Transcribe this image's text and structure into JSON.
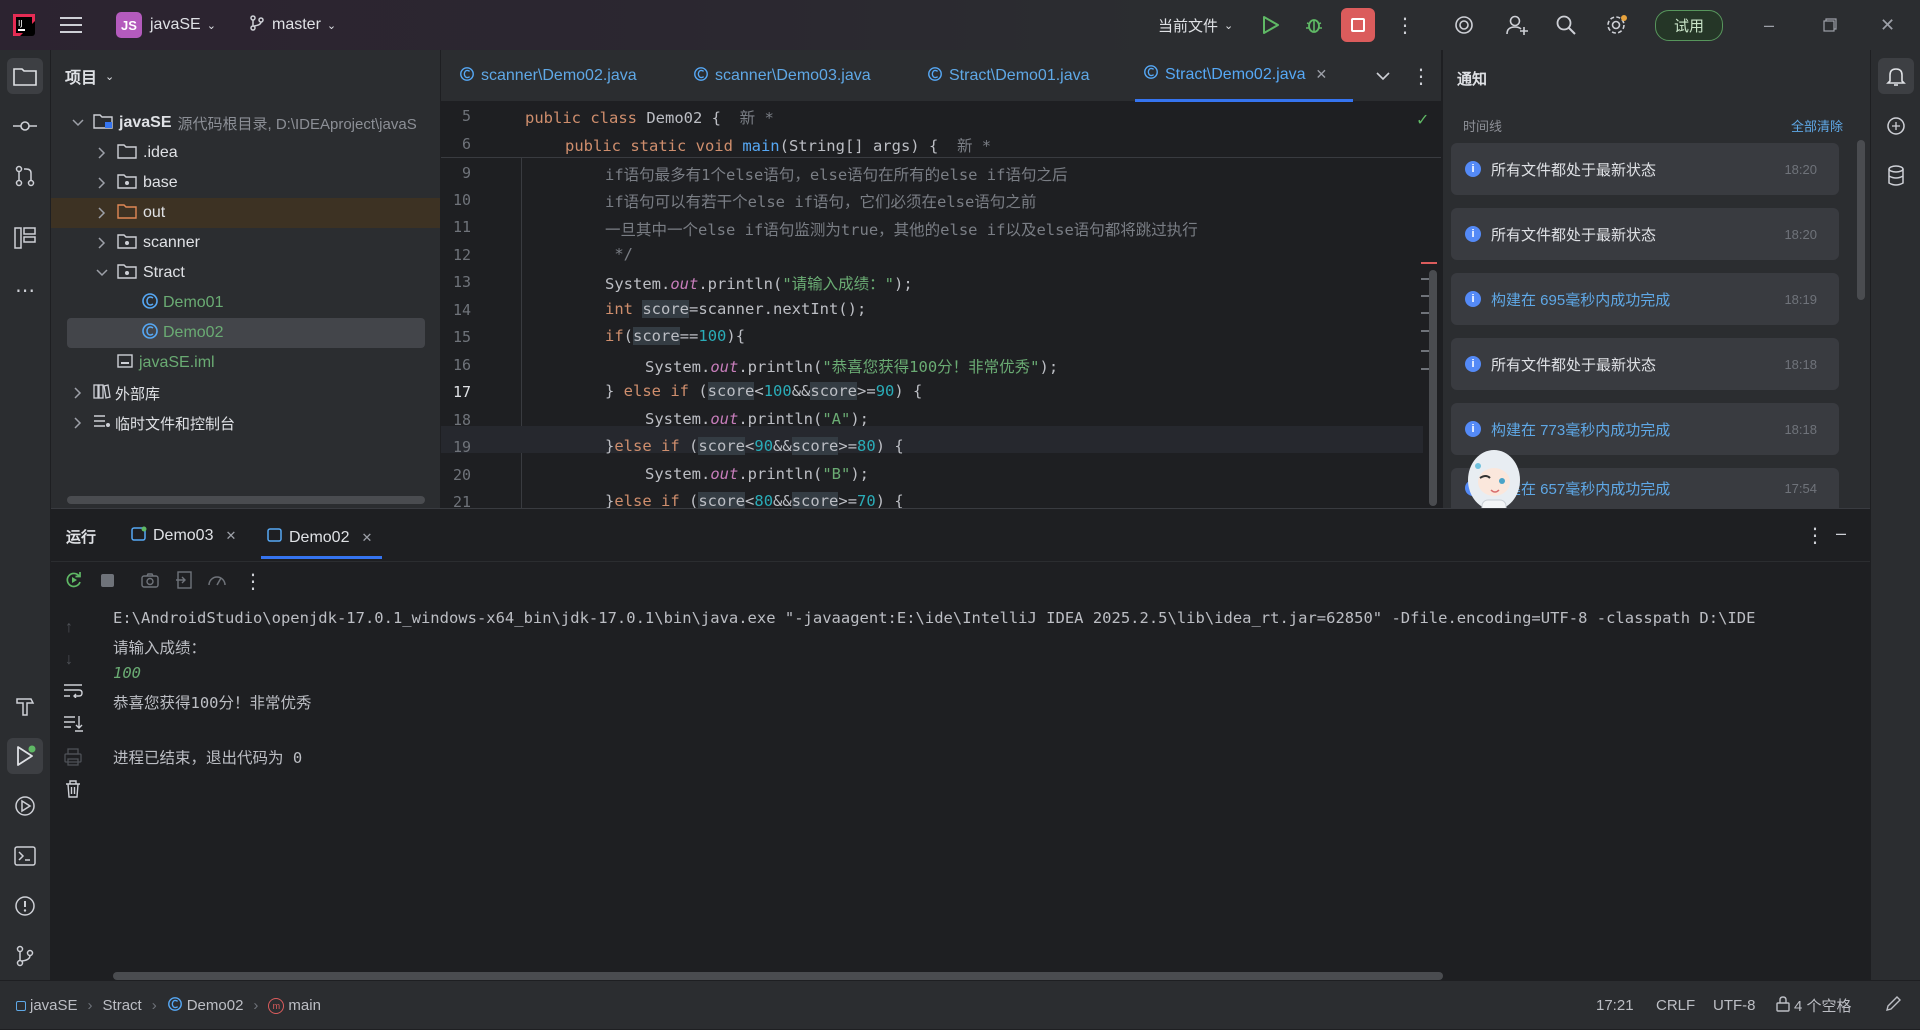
{
  "titlebar": {
    "logo": "intellij-logo",
    "project_badge": "JS",
    "project_name": "javaSE",
    "branch": "master",
    "run_config": "当前文件",
    "trial": "试用"
  },
  "project_panel": {
    "title": "项目",
    "root_name": "javaSE",
    "root_hint": "源代码根目录, D:\\IDEAproject\\javaSE",
    "items": [
      {
        "label": ".idea"
      },
      {
        "label": "base"
      },
      {
        "label": "out"
      },
      {
        "label": "scanner"
      },
      {
        "label": "Stract"
      },
      {
        "label": "Demo01"
      },
      {
        "label": "Demo02"
      },
      {
        "label": "javaSE.iml"
      },
      {
        "label": "外部库"
      },
      {
        "label": "临时文件和控制台"
      }
    ]
  },
  "editor": {
    "tabs": [
      {
        "label": "scanner\\Demo02.java"
      },
      {
        "label": "scanner\\Demo03.java"
      },
      {
        "label": "Stract\\Demo01.java"
      },
      {
        "label": "Stract\\Demo02.java"
      }
    ],
    "line_numbers": [
      "5",
      "6",
      "9",
      "10",
      "11",
      "12",
      "13",
      "14",
      "15",
      "16",
      "17",
      "18",
      "19",
      "20",
      "21"
    ],
    "sticky_hint": "新 *",
    "sticky_hint2": "新 *",
    "comment1": "if语句最多有1个else语句，else语句在所有的else if语句之后",
    "comment2": "if语句可以有若干个else if语句，它们必须在else语句之前",
    "comment3": "一旦其中一个else if语句监测为true，其他的else if以及else语句都将跳过执行",
    "comment4": " */",
    "str_prompt": "\"请输入成绩：\"",
    "str_congrats": "\"恭喜您获得100分！非常优秀\"",
    "str_a": "\"A\"",
    "str_b": "\"B\""
  },
  "notifications": {
    "title": "通知",
    "timeline": "时间线",
    "clear_all": "全部清除",
    "items": [
      {
        "text": "所有文件都处于最新状态",
        "time": "18:20",
        "link": false
      },
      {
        "text": "所有文件都处于最新状态",
        "time": "18:20",
        "link": false
      },
      {
        "text": "构建在 695毫秒内成功完成",
        "time": "18:19",
        "link": true
      },
      {
        "text": "所有文件都处于最新状态",
        "time": "18:18",
        "link": false
      },
      {
        "text": "构建在 773毫秒内成功完成",
        "time": "18:18",
        "link": true
      },
      {
        "text": "构建在 657毫秒内成功完成",
        "time": "17:54",
        "link": true
      }
    ]
  },
  "run_panel": {
    "title": "运行",
    "tabs": [
      {
        "label": "Demo03"
      },
      {
        "label": "Demo02"
      }
    ],
    "console": {
      "command": "E:\\AndroidStudio\\openjdk-17.0.1_windows-x64_bin\\jdk-17.0.1\\bin\\java.exe \"-javaagent:E:\\ide\\IntelliJ IDEA 2025.2.5\\lib\\idea_rt.jar=62850\" -Dfile.encoding=UTF-8 -classpath D:\\IDE",
      "prompt": "请输入成绩：",
      "input": "100",
      "output": "恭喜您获得100分！非常优秀",
      "exit": "进程已结束，退出代码为 0"
    }
  },
  "statusbar": {
    "breadcrumbs": [
      "javaSE",
      "Stract",
      "Demo02",
      "main"
    ],
    "position": "17:21",
    "line_sep": "CRLF",
    "encoding": "UTF-8",
    "indent": "4 个空格"
  },
  "colors": {
    "accent": "#3574f0",
    "keyword": "#cf8e6d",
    "string": "#6aab73",
    "number": "#2aacb8",
    "function": "#56a8f5",
    "link": "#5fa8e6",
    "stop": "#db5c5c",
    "trial_green": "#57965c"
  }
}
